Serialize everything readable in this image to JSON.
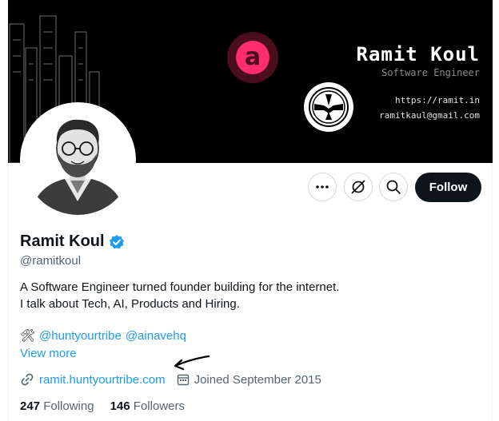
{
  "banner": {
    "name": "Ramit Koul",
    "role": "Software Engineer",
    "url": "https://ramit.in",
    "email": "ramitkaul@gmail.com",
    "logo_letter": "a",
    "logo_colors": {
      "outer": "#4a0e1d",
      "inner": "#ff2d6f"
    }
  },
  "actions": {
    "follow_label": "Follow",
    "more_icon": "more-horizontal-icon",
    "grok_icon": "grok-icon",
    "search_icon": "search-icon"
  },
  "profile": {
    "display_name": "Ramit Koul",
    "verified": true,
    "handle": "@ramitkoul",
    "bio_lines": [
      "A Software Engineer turned founder building for the internet.",
      "I talk about Tech, AI, Products and Hiring."
    ],
    "mentions_emoji": "🛠",
    "mentions": [
      "@huntyourtribe",
      "@ainavehq"
    ],
    "view_more": "View more",
    "website": "ramit.huntyourtribe.com",
    "joined": "Joined September 2015",
    "following_count": "247",
    "following_label": "Following",
    "followers_count": "146",
    "followers_label": "Followers"
  },
  "colors": {
    "accent": "#1d9bf0",
    "text": "#0f1419",
    "muted": "#536471",
    "follow_bg": "#0f1419"
  }
}
